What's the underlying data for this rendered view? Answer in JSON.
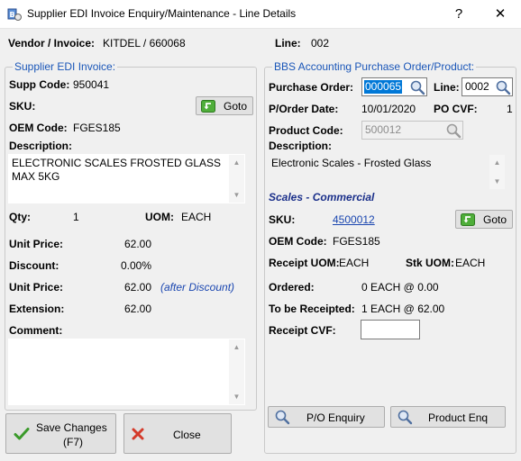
{
  "window": {
    "title": "Supplier EDI Invoice Enquiry/Maintenance - Line Details",
    "help_label": "?",
    "close_label": "✕"
  },
  "header": {
    "vendor_invoice_label": "Vendor / Invoice:",
    "vendor_invoice_value": "KITDEL / 660068",
    "line_label": "Line:",
    "line_value": "002"
  },
  "left": {
    "legend": "Supplier EDI Invoice:",
    "supp_code_label": "Supp Code:",
    "supp_code_value": "950041",
    "sku_label": "SKU:",
    "goto_label": "Goto",
    "oem_code_label": "OEM Code:",
    "oem_code_value": "FGES185",
    "description_label": "Description:",
    "description_value": "ELECTRONIC SCALES FROSTED GLASS\nMAX 5KG",
    "qty_label": "Qty:",
    "qty_value": "1",
    "uom_label": "UOM:",
    "uom_value": "EACH",
    "unit_price_label": "Unit Price:",
    "unit_price_value": "62.00",
    "discount_label": "Discount:",
    "discount_value": "0.00%",
    "unit_price2_label": "Unit Price:",
    "unit_price2_value": "62.00",
    "after_discount_note": "(after Discount)",
    "extension_label": "Extension:",
    "extension_value": "62.00",
    "comment_label": "Comment:",
    "comment_value": ""
  },
  "right": {
    "legend": "BBS Accounting Purchase Order/Product:",
    "purchase_order_label": "Purchase Order:",
    "purchase_order_value": "000065",
    "line_label": "Line:",
    "line_value": "0002",
    "po_date_label": "P/Order Date:",
    "po_date_value": "10/01/2020",
    "po_cvf_label": "PO CVF:",
    "po_cvf_value": "1",
    "product_code_label": "Product Code:",
    "product_code_value": "500012",
    "description_label": "Description:",
    "description_value": "Electronic Scales - Frosted Glass",
    "category_title": "Scales - Commercial",
    "sku_label": "SKU:",
    "sku_value": "4500012",
    "goto_label": "Goto",
    "oem_code_label": "OEM Code:",
    "oem_code_value": "FGES185",
    "receipt_uom_label": "Receipt UOM:",
    "receipt_uom_value": "EACH",
    "stk_uom_label": "Stk UOM:",
    "stk_uom_value": "EACH",
    "ordered_label": "Ordered:",
    "ordered_value": "0 EACH @ 0.00",
    "to_be_receipted_label": "To be Receipted:",
    "to_be_receipted_value": "1 EACH @ 62.00",
    "receipt_cvf_label": "Receipt CVF:",
    "receipt_cvf_value": "",
    "po_enquiry_label": "P/O Enquiry",
    "product_enq_label": "Product Enq"
  },
  "footer": {
    "save_label_line1": "Save Changes",
    "save_label_line2": "(F7)",
    "close_label": "Close"
  },
  "colors": {
    "legend_blue": "#1a56b8",
    "link_blue": "#1a46b0",
    "selection_blue": "#0078d7",
    "goto_green": "#3a9a2a",
    "close_red": "#d43a2a"
  },
  "icons": {
    "app": "app-icon",
    "goto": "goto-arrow-icon",
    "search": "magnifier-icon",
    "save": "checkmark-icon",
    "close": "x-icon"
  }
}
